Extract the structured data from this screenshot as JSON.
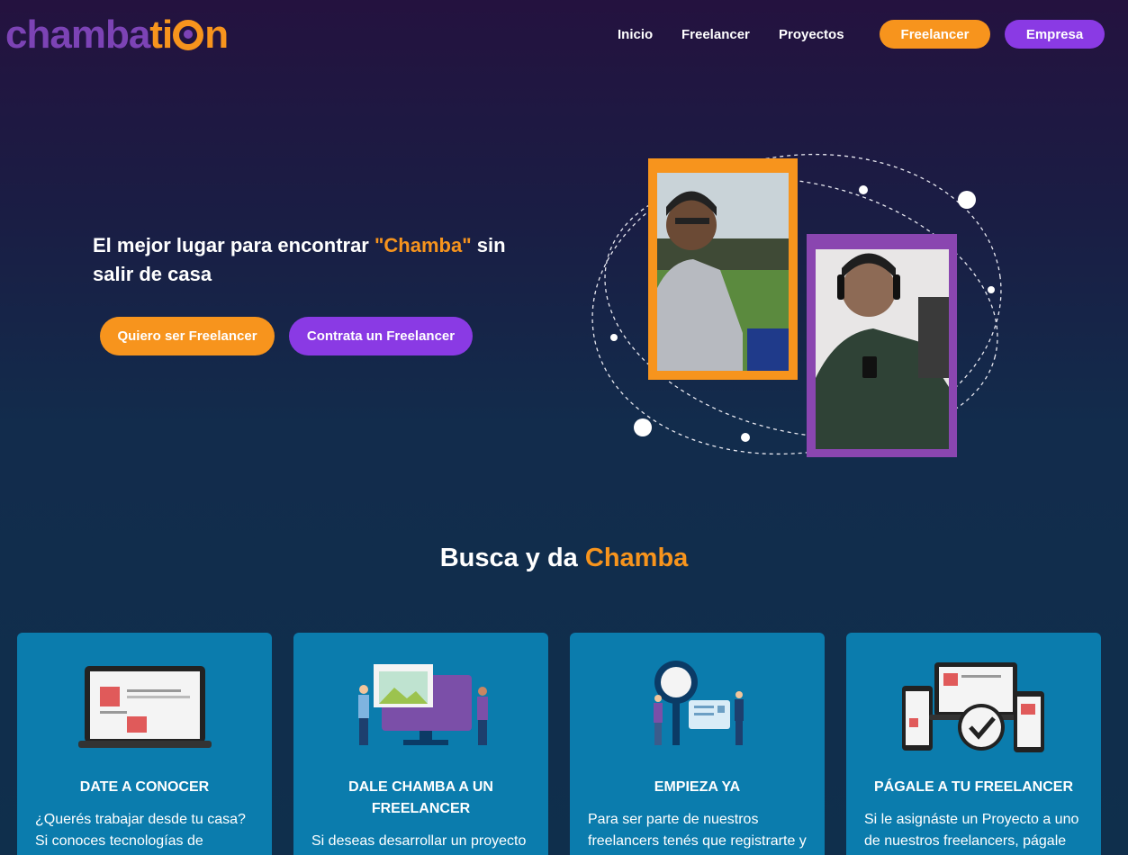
{
  "header": {
    "logo": {
      "part1": "chamba",
      "part2": "ti",
      "part3": "n"
    },
    "nav": [
      "Inicio",
      "Freelancer",
      "Proyectos"
    ],
    "buttons": {
      "freelancer": "Freelancer",
      "empresa": "Empresa"
    }
  },
  "hero": {
    "title_before": "El mejor lugar para encontrar ",
    "title_highlight": "\"Chamba\"",
    "title_after": " sin salir de casa",
    "cta_primary": "Quiero ser Freelancer",
    "cta_secondary": "Contrata un Freelancer"
  },
  "section": {
    "title_before": "Busca y da ",
    "title_highlight": "Chamba"
  },
  "cards": [
    {
      "title": "DATE A CONOCER",
      "text": "¿Querés trabajar desde tu casa? Si conoces tecnologías de"
    },
    {
      "title": "DALE CHAMBA A UN FREELANCER",
      "text": "Si deseas desarrollar un proyecto"
    },
    {
      "title": "EMPIEZA YA",
      "text": "Para ser parte de nuestros freelancers tenés que registrarte y"
    },
    {
      "title": "PÁGALE A TU FREELANCER",
      "text": "Si le asignáste un Proyecto a uno de nuestros freelancers, págale"
    }
  ],
  "colors": {
    "orange": "#f7941d",
    "purple": "#8a3ae4",
    "card": "#0b7cad"
  }
}
